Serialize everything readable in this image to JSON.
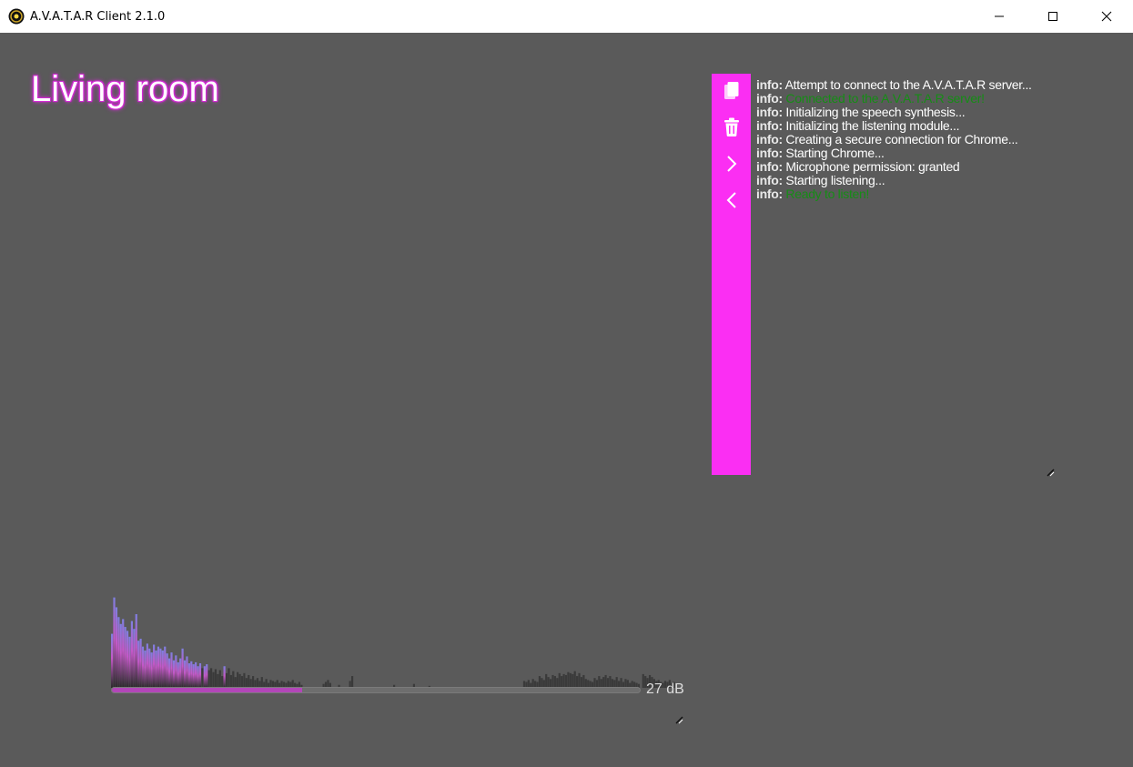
{
  "window": {
    "title": "A.V.A.T.A.R Client 2.1.0",
    "controls": [
      "minimize-icon",
      "maximize-icon",
      "close-icon"
    ]
  },
  "room": {
    "name": "Living room"
  },
  "toolbar": {
    "buttons": [
      "copy-icon",
      "trash-icon",
      "chevron-right-icon",
      "chevron-left-icon"
    ],
    "color": "#fb2ef3"
  },
  "log": {
    "entries": [
      {
        "level": "info:",
        "message": "Attempt to connect to the A.V.A.T.A.R server...",
        "status": "normal"
      },
      {
        "level": "info:",
        "message": "Connected to the A.V.A.T.A.R server!",
        "status": "ok"
      },
      {
        "level": "info:",
        "message": "Initializing the speech synthesis...",
        "status": "normal"
      },
      {
        "level": "info:",
        "message": "Initializing the listening module...",
        "status": "normal"
      },
      {
        "level": "info:",
        "message": "Creating a secure connection for Chrome...",
        "status": "normal"
      },
      {
        "level": "info:",
        "message": "Starting Chrome...",
        "status": "normal"
      },
      {
        "level": "info:",
        "message": "Microphone permission: granted",
        "status": "normal"
      },
      {
        "level": "info:",
        "message": "Starting listening...",
        "status": "normal"
      },
      {
        "level": "info:",
        "message": "Ready to listen!",
        "status": "ok"
      }
    ],
    "ok_color": "#168c16"
  },
  "audio": {
    "level_db": "27 dB",
    "level_fraction": 0.36,
    "accent_color": "#b246b8",
    "spectrum": [
      0.55,
      0.92,
      0.82,
      0.72,
      0.65,
      0.7,
      0.62,
      0.58,
      0.52,
      0.68,
      0.6,
      0.75,
      0.48,
      0.5,
      0.42,
      0.38,
      0.45,
      0.4,
      0.36,
      0.44,
      0.38,
      0.42,
      0.4,
      0.38,
      0.42,
      0.35,
      0.3,
      0.36,
      0.28,
      0.33,
      0.26,
      0.3,
      0.4,
      0.28,
      0.32,
      0.25,
      0.27,
      0.24,
      0.26,
      0.22,
      0.25,
      0.2,
      0.22,
      0.24,
      0.18,
      0.2,
      0.16,
      0.19,
      0.14,
      0.18,
      0.12,
      0.22,
      0.15,
      0.2,
      0.13,
      0.17,
      0.11,
      0.16,
      0.14,
      0.12,
      0.15,
      0.1,
      0.13,
      0.09,
      0.12,
      0.08,
      0.1,
      0.07,
      0.11,
      0.06,
      0.09,
      0.05,
      0.08,
      0.07,
      0.06,
      0.08,
      0.05,
      0.07,
      0.06,
      0.05,
      0.07,
      0.06,
      0.08,
      0.05,
      0.04,
      0.06,
      0.03,
      0.0,
      0.0,
      0.0,
      0.0,
      0.0,
      0.0,
      0.0,
      0.0,
      0.0,
      0.04,
      0.06,
      0.08,
      0.05,
      0.0,
      0.0,
      0.0,
      0.03,
      0.0,
      0.0,
      0.0,
      0.0,
      0.07,
      0.12,
      0.0,
      0.0,
      0.0,
      0.0,
      0.0,
      0.0,
      0.0,
      0.0,
      0.0,
      0.0,
      0.0,
      0.0,
      0.0,
      0.0,
      0.0,
      0.0,
      0.0,
      0.0,
      0.03,
      0.0,
      0.0,
      0.0,
      0.0,
      0.0,
      0.0,
      0.0,
      0.0,
      0.04,
      0.0,
      0.0,
      0.0,
      0.0,
      0.0,
      0.0,
      0.02,
      0.0,
      0.0,
      0.0,
      0.0,
      0.0,
      0.0,
      0.0,
      0.0,
      0.0,
      0.0,
      0.0,
      0.0,
      0.0,
      0.0,
      0.0,
      0.0,
      0.0,
      0.0,
      0.0,
      0.0,
      0.0,
      0.0,
      0.0,
      0.0,
      0.0,
      0.0,
      0.0,
      0.0,
      0.0,
      0.0,
      0.0,
      0.0,
      0.0,
      0.0,
      0.0,
      0.0,
      0.0,
      0.0,
      0.0,
      0.0,
      0.0,
      0.0,
      0.07,
      0.06,
      0.08,
      0.05,
      0.09,
      0.07,
      0.06,
      0.12,
      0.1,
      0.08,
      0.14,
      0.11,
      0.09,
      0.13,
      0.12,
      0.1,
      0.15,
      0.12,
      0.14,
      0.13,
      0.16,
      0.15,
      0.14,
      0.17,
      0.12,
      0.15,
      0.11,
      0.13,
      0.09,
      0.08,
      0.07,
      0.06,
      0.1,
      0.08,
      0.12,
      0.09,
      0.11,
      0.13,
      0.1,
      0.12,
      0.09,
      0.08,
      0.11,
      0.07,
      0.1,
      0.06,
      0.09,
      0.08,
      0.05,
      0.07,
      0.06,
      0.05,
      0.04,
      0.0,
      0.14,
      0.12,
      0.1,
      0.13,
      0.11,
      0.09,
      0.07,
      0.08,
      0.06,
      0.05,
      0.07,
      0.06,
      0.08,
      0.05,
      0.06
    ]
  }
}
